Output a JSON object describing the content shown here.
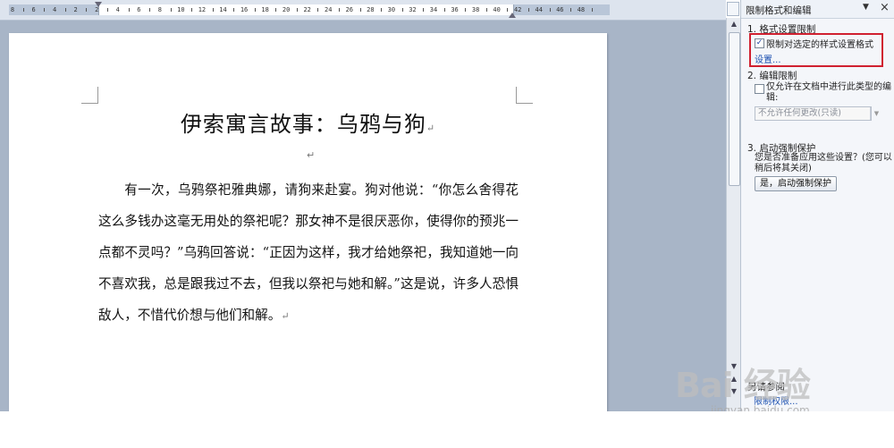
{
  "ruler": {
    "labels": [
      "8",
      "6",
      "4",
      "2",
      "2",
      "4",
      "6",
      "8",
      "10",
      "12",
      "14",
      "16",
      "18",
      "20",
      "22",
      "24",
      "26",
      "28",
      "30",
      "32",
      "34",
      "36",
      "38",
      "40",
      "42",
      "44",
      "46",
      "48"
    ]
  },
  "document": {
    "title": "伊索寓言故事：乌鸦与狗",
    "paragraph_mark": "↵",
    "body": "有一次，乌鸦祭祀雅典娜，请狗来赴宴。狗对他说：“你怎么舍得花这么多钱办这毫无用处的祭祀呢？那女神不是很厌恶你，使得你的预兆一点都不灵吗？”乌鸦回答说：“正因为这样，我才给她祭祀，我知道她一向不喜欢我，总是跟我过不去，但我以祭祀与她和解。”这是说，许多人恐惧敌人，不惜代价想与他们和解。"
  },
  "task_pane": {
    "title": "限制格式和编辑",
    "dropdown_icon": "▼",
    "close_icon": "×",
    "section1": {
      "heading": "1. 格式设置限制",
      "checkbox_label": "限制对选定的样式设置格式",
      "checked": true,
      "check_mark": "✓",
      "link": "设置..."
    },
    "section2": {
      "heading": "2. 编辑限制",
      "checkbox_label": "仅允许在文档中进行此类型的编辑:",
      "checked": false,
      "select_value": "不允许任何更改(只读)",
      "select_arrow": "▼"
    },
    "section3": {
      "heading": "3. 启动强制保护",
      "text": "您是否准备应用这些设置？(您可以稍后将其关闭)",
      "button": "是，启动强制保护"
    },
    "section4": {
      "heading": "另请参阅",
      "link": "限制权限..."
    }
  },
  "scrollbar": {
    "up": "▲",
    "down": "▼",
    "prev_page": "▲",
    "next_page": "▼"
  },
  "watermark": {
    "text": "Bai 经验",
    "sub": "jingyan.baidu.com"
  },
  "colors": {
    "ruler_bg": "#dde4ee",
    "doc_bg": "#a8b5c7",
    "pane_bg": "#f4f6fa",
    "highlight": "#d02030",
    "link": "#1a4fb0"
  }
}
